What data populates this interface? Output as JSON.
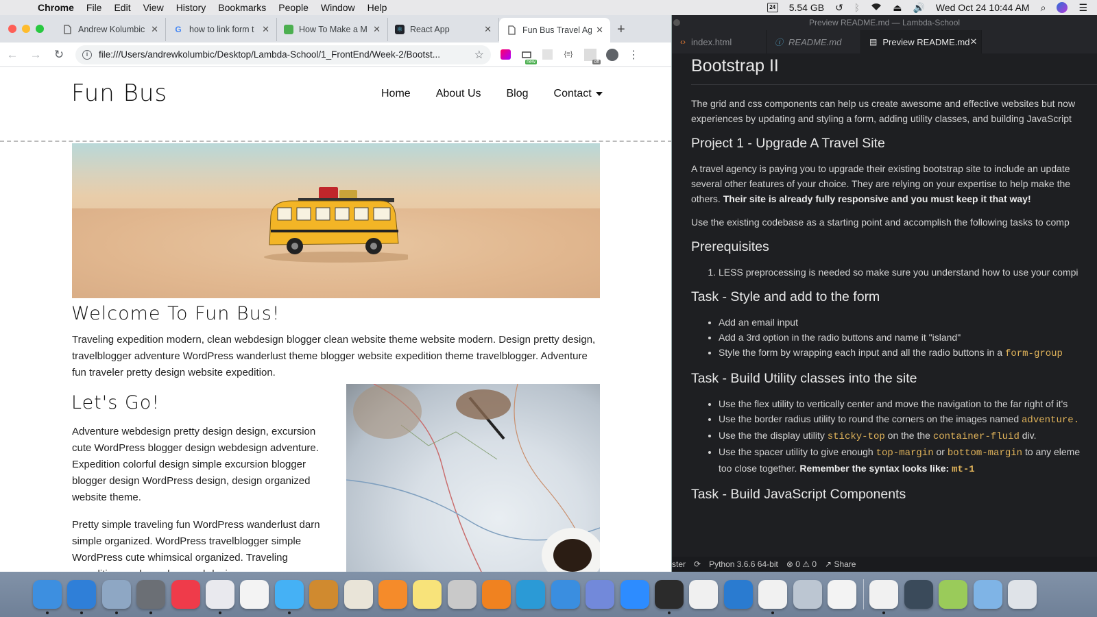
{
  "menubar": {
    "app": "Chrome",
    "items": [
      "File",
      "Edit",
      "View",
      "History",
      "Bookmarks",
      "People",
      "Window",
      "Help"
    ],
    "calendar_day": "24",
    "memory": "5.54 GB",
    "datetime": "Wed Oct 24  10:44 AM"
  },
  "chrome": {
    "tabs": [
      {
        "title": "Andrew Kolumbic",
        "icon": "document-icon"
      },
      {
        "title": "how to link form t",
        "icon": "google-icon"
      },
      {
        "title": "How To Make a M",
        "icon": "green-app-icon"
      },
      {
        "title": "React App",
        "icon": "react-icon"
      },
      {
        "title": "Fun Bus Travel Ag",
        "icon": "document-icon",
        "active": true
      }
    ],
    "url": "file:///Users/andrewkolumbic/Desktop/Lambda-School/1_FrontEnd/Week-2/Bootst...",
    "extension_badges": [
      "new",
      "off"
    ]
  },
  "site": {
    "logo": "Fun Bus",
    "nav": [
      "Home",
      "About Us",
      "Blog",
      "Contact"
    ],
    "welcome_heading": "Welcome To Fun Bus!",
    "intro": "Traveling expedition modern, clean webdesign blogger clean website theme website modern. Design pretty design, travelblogger adventure WordPress wanderlust theme blogger website expedition theme travelblogger. Adventure fun traveler pretty design website expedition.",
    "letsgo_heading": "Let's Go!",
    "para1": "Adventure webdesign pretty design design, excursion cute WordPress blogger design webdesign adventure. Expedition colorful design simple excursion blogger blogger design WordPress design, design organized website theme.",
    "para2": "Pretty simple traveling fun WordPress wanderlust darn simple organized. WordPress travelblogger simple WordPress cute whimsical organized. Traveling expedition modern, clean webdesign"
  },
  "vscode": {
    "window_title": "Preview README.md — Lambda-School",
    "tabs": [
      "index.html",
      "README.md",
      "Preview README.md"
    ],
    "h1": "Bootstrap II",
    "p1_l1": "The grid and css components can help us create awesome and effective websites but now",
    "p1_l2": "experiences by updating and styling a form, adding utility classes, and building JavaScript",
    "h2_project": "Project 1 - Upgrade A Travel Site",
    "p2_l1": "A travel agency is paying you to upgrade their existing bootstrap site to include an update",
    "p2_l2": "several other features of your choice. They are relying on your expertise to help make the",
    "p2_l3": "others.",
    "p2_bold": "Their site is already fully responsive and you must keep it that way!",
    "p3": "Use the existing codebase as a starting point and accomplish the following tasks to comp",
    "h2_prereq": "Prerequisites",
    "prereq_1": "LESS preprocessing is needed so make sure you understand how to use your compi",
    "h2_task_form": "Task - Style and add to the form",
    "form_1": "Add an email input",
    "form_2": "Add a 3rd option in the radio buttons and name it \"island\"",
    "form_3_pre": "Style the form by wrapping each input and all the radio buttons in a",
    "form_3_code": "form-group",
    "h2_task_util": "Task - Build Utility classes into the site",
    "util_1": "Use the flex utility to vertically center and move the navigation to the far right of it's",
    "util_2_pre": "Use the border radius utility to round the corners on the images named",
    "util_2_code": "adventure.",
    "util_3_pre": "Use the the display utility",
    "util_3_code1": "sticky-top",
    "util_3_mid": "on the the",
    "util_3_code2": "container-fluid",
    "util_3_post": "div.",
    "util_4_pre": "Use the spacer utility to give enough",
    "util_4_code1": "top-margin",
    "util_4_or": "or",
    "util_4_code2": "bottom-margin",
    "util_4_post": "to any eleme",
    "util_4_l2": "too close together.",
    "util_4_bold": "Remember the syntax looks like:",
    "util_4_code3": "mt-1",
    "h2_task_js": "Task - Build JavaScript Components",
    "status_branch": "ster",
    "status_python": "Python 3.6.6 64-bit",
    "status_errors": "0",
    "status_warnings": "0",
    "status_share": "Share"
  },
  "dock": {
    "apps": [
      {
        "name": "Finder",
        "color": "#3d8fe0"
      },
      {
        "name": "Safari",
        "color": "#2f7fd8"
      },
      {
        "name": "Mail",
        "color": "#8ea7c4"
      },
      {
        "name": "System Preferences",
        "color": "#6b6f75"
      },
      {
        "name": "News",
        "color": "#ef3b4a"
      },
      {
        "name": "iTunes",
        "color": "#e9e9ee"
      },
      {
        "name": "Photos",
        "color": "#f3f3f3"
      },
      {
        "name": "Messages",
        "color": "#45b1f5"
      },
      {
        "name": "GarageBand",
        "color": "#d08a2f"
      },
      {
        "name": "TextEdit",
        "color": "#e9e4d8"
      },
      {
        "name": "Books",
        "color": "#f58b2a"
      },
      {
        "name": "Notes",
        "color": "#f8e37a"
      },
      {
        "name": "Script Editor",
        "color": "#c9c9c9"
      },
      {
        "name": "VLC",
        "color": "#f08220"
      },
      {
        "name": "Kodi",
        "color": "#2b9ad6"
      },
      {
        "name": "Simplenote",
        "color": "#3a8ee0"
      },
      {
        "name": "Discord",
        "color": "#7289da"
      },
      {
        "name": "Zoom",
        "color": "#2d8cff"
      },
      {
        "name": "Terminal",
        "color": "#2b2b2b"
      },
      {
        "name": "Scrivener",
        "color": "#f0f0f0"
      },
      {
        "name": "VS Code",
        "color": "#2a7bd0"
      },
      {
        "name": "Chrome",
        "color": "#f1f1f1"
      },
      {
        "name": "Preview",
        "color": "#bcc6d2"
      },
      {
        "name": "MongoDB Compass",
        "color": "#f3f3f3"
      },
      {
        "name": "Chrome",
        "color": "#f1f1f1"
      },
      {
        "name": "Atom",
        "color": "#3a4a5a"
      },
      {
        "name": "Android Studio",
        "color": "#9acb5a"
      },
      {
        "name": "Downloads",
        "color": "#7fb4e6"
      },
      {
        "name": "Trash",
        "color": "#dfe3e8"
      }
    ]
  }
}
